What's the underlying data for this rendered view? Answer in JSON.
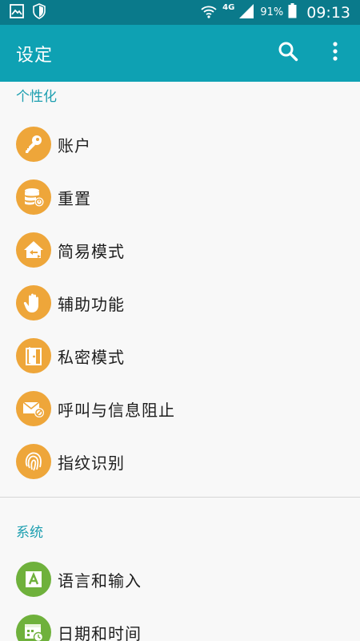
{
  "status_bar": {
    "network": "4G",
    "battery": "91%",
    "time": "09:13"
  },
  "app_bar": {
    "title": "设定"
  },
  "sections": {
    "personalization": {
      "header": "个性化",
      "items": [
        {
          "label": "账户",
          "icon": "key-icon"
        },
        {
          "label": "重置",
          "icon": "backup-reset-icon"
        },
        {
          "label": "简易模式",
          "icon": "easy-mode-home-icon"
        },
        {
          "label": "辅助功能",
          "icon": "hand-icon"
        },
        {
          "label": "私密模式",
          "icon": "private-mode-door-icon"
        },
        {
          "label": "呼叫与信息阻止",
          "icon": "envelope-block-icon"
        },
        {
          "label": "指纹识别",
          "icon": "fingerprint-icon"
        }
      ]
    },
    "system": {
      "header": "系统",
      "items": [
        {
          "label": "语言和输入",
          "icon": "language-a-icon"
        },
        {
          "label": "日期和时间",
          "icon": "calendar-clock-icon"
        }
      ]
    }
  },
  "colors": {
    "status_bar": "#0a7a8b",
    "app_bar": "#0ea1b3",
    "section_header": "#1d9fb0",
    "icon_orange": "#eea63a",
    "icon_green": "#6fb13c"
  }
}
